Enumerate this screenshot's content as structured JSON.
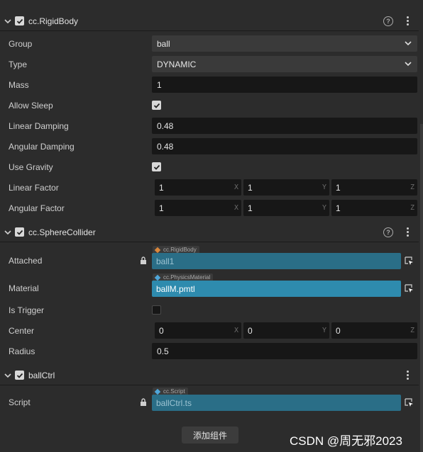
{
  "rigidbody": {
    "title": "cc.RigidBody",
    "group_label": "Group",
    "group_value": "ball",
    "type_label": "Type",
    "type_value": "DYNAMIC",
    "mass_label": "Mass",
    "mass_value": "1",
    "allow_sleep_label": "Allow Sleep",
    "allow_sleep_checked": true,
    "linear_damping_label": "Linear Damping",
    "linear_damping_value": "0.48",
    "angular_damping_label": "Angular Damping",
    "angular_damping_value": "0.48",
    "use_gravity_label": "Use Gravity",
    "use_gravity_checked": true,
    "linear_factor_label": "Linear Factor",
    "linear_factor": {
      "x": "1",
      "y": "1",
      "z": "1"
    },
    "angular_factor_label": "Angular Factor",
    "angular_factor": {
      "x": "1",
      "y": "1",
      "z": "1"
    }
  },
  "axis": {
    "x": "X",
    "y": "Y",
    "z": "Z"
  },
  "sphere_collider": {
    "title": "cc.SphereCollider",
    "attached_label": "Attached",
    "attached_tag": "cc.RigidBody",
    "attached_value": "ball1",
    "material_label": "Material",
    "material_tag": "cc.PhysicsMaterial",
    "material_value": "ballM.pmtl",
    "is_trigger_label": "Is Trigger",
    "is_trigger_checked": false,
    "center_label": "Center",
    "center": {
      "x": "0",
      "y": "0",
      "z": "0"
    },
    "radius_label": "Radius",
    "radius_value": "0.5"
  },
  "ball_ctrl": {
    "title": "ballCtrl",
    "script_label": "Script",
    "script_tag": "cc.Script",
    "script_value": "ballCtrl.ts"
  },
  "add_component_label": "添加组件",
  "watermark": "CSDN @周无邪2023",
  "colors": {
    "background": "#2c2c2c",
    "field": "#171717",
    "ref_field": "#2a6e87",
    "ref_field_active": "#2e8bae",
    "orange_tag": "#d9873c",
    "blue_tag": "#4fa6d9"
  }
}
